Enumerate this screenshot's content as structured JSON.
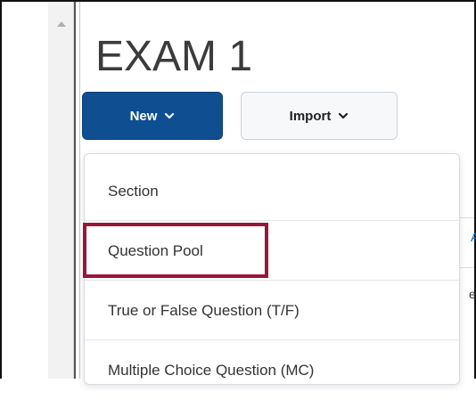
{
  "page": {
    "title": "EXAM 1"
  },
  "toolbar": {
    "new_label": "New",
    "import_label": "Import"
  },
  "new_menu": {
    "items": [
      {
        "label": "Section"
      },
      {
        "label": "Question Pool"
      },
      {
        "label": "True or False Question (T/F)"
      },
      {
        "label": "Multiple Choice Question (MC)"
      }
    ],
    "highlighted_item": "Question Pool"
  },
  "background_fragments": {
    "partial_a": "A",
    "partial_b": "e"
  },
  "icons": {
    "new_caret": "chevron-down-icon",
    "import_caret": "chevron-down-icon",
    "scroll_up": "arrow-up-icon"
  },
  "colors": {
    "primary_button": "#0f4f91",
    "highlight": "#99163a",
    "title_text": "#3b3b3b",
    "link_blue": "#006fbf"
  }
}
